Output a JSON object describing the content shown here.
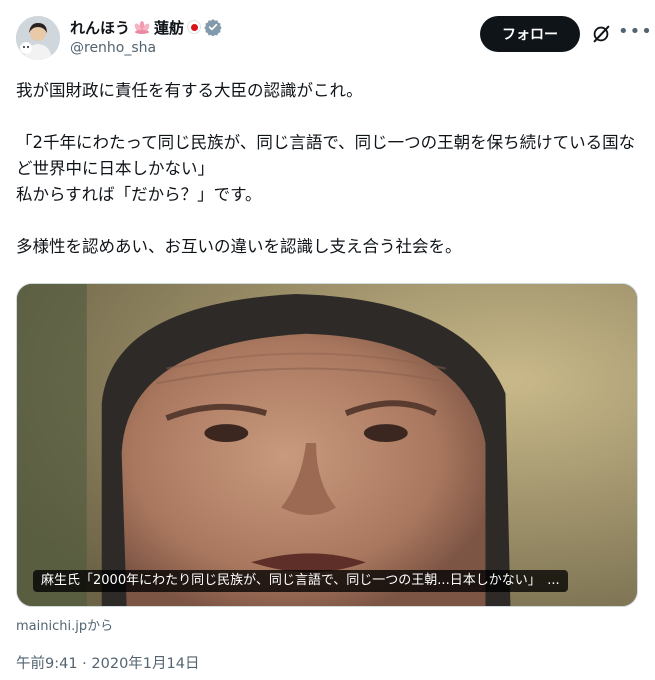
{
  "user": {
    "display_name": "れんほう",
    "display_name_kanji": "蓮舫",
    "handle": "@renho_sha",
    "avatar_icon": "profile-photo",
    "verified": true,
    "flag": "japan"
  },
  "actions": {
    "follow_label": "フォロー"
  },
  "tweet": {
    "line1": "我が国財政に責任を有する大臣の認識がこれ。",
    "line2": "「2千年にわたって同じ民族が、同じ言語で、同じ一つの王朝を保ち続けている国など世界中に日本しかない」",
    "line3": "私からすれば「だから？」です。",
    "line4": "多様性を認めあい、お互いの違いを認識し支え合う社会を。"
  },
  "card": {
    "caption": "麻生氏「2000年にわたり同じ民族が、同じ言語で、同じ一つの王朝...日本しかない」　...",
    "source": "mainichi.jpから"
  },
  "meta": {
    "timestamp": "午前9:41 · 2020年1月14日"
  },
  "colors": {
    "text": "#0f1419",
    "muted": "#536471",
    "button_bg": "#0f1419",
    "verified": "#829aab",
    "flag_red": "#d7141a"
  }
}
